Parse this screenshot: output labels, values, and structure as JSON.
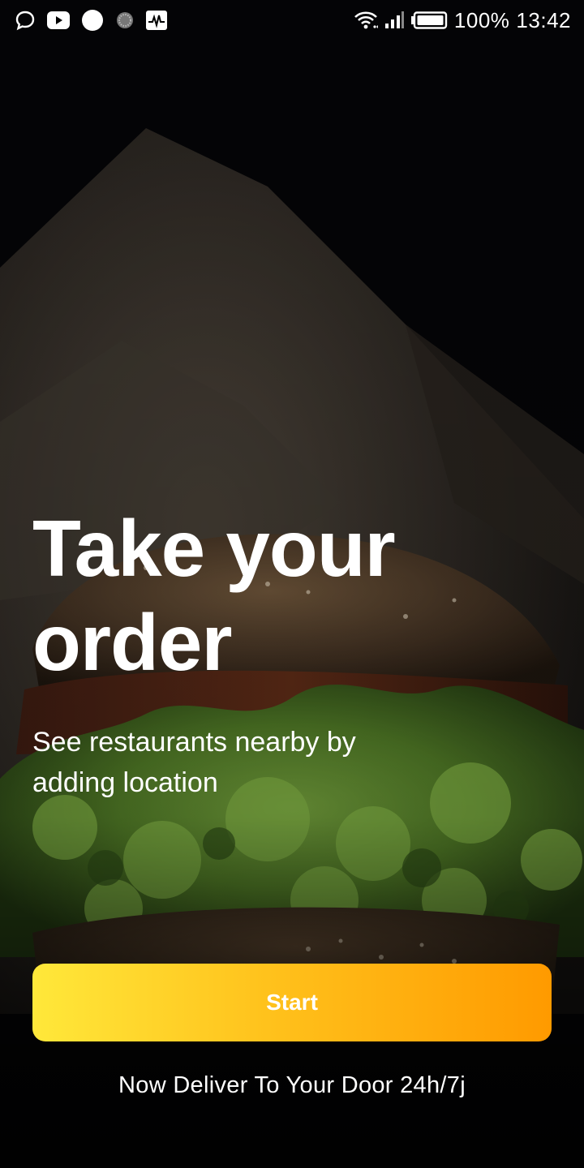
{
  "status_bar": {
    "battery": "100%",
    "time": "13:42"
  },
  "hero": {
    "title_line1": "Take your",
    "title_line2": "order",
    "subtitle": "See restaurants nearby by adding location"
  },
  "actions": {
    "start_label": "Start"
  },
  "footer": {
    "tagline": "Now Deliver To Your Door 24h/7j"
  },
  "colors": {
    "button_gradient_start": "#ffe83a",
    "button_gradient_end": "#ff9a00",
    "text": "#ffffff",
    "background": "#040406"
  },
  "icons": [
    "chat-bubble-icon",
    "youtube-icon",
    "circle-notification-icon",
    "loading-dots-icon",
    "activity-pulse-icon",
    "wifi-icon",
    "signal-icon",
    "battery-icon"
  ]
}
